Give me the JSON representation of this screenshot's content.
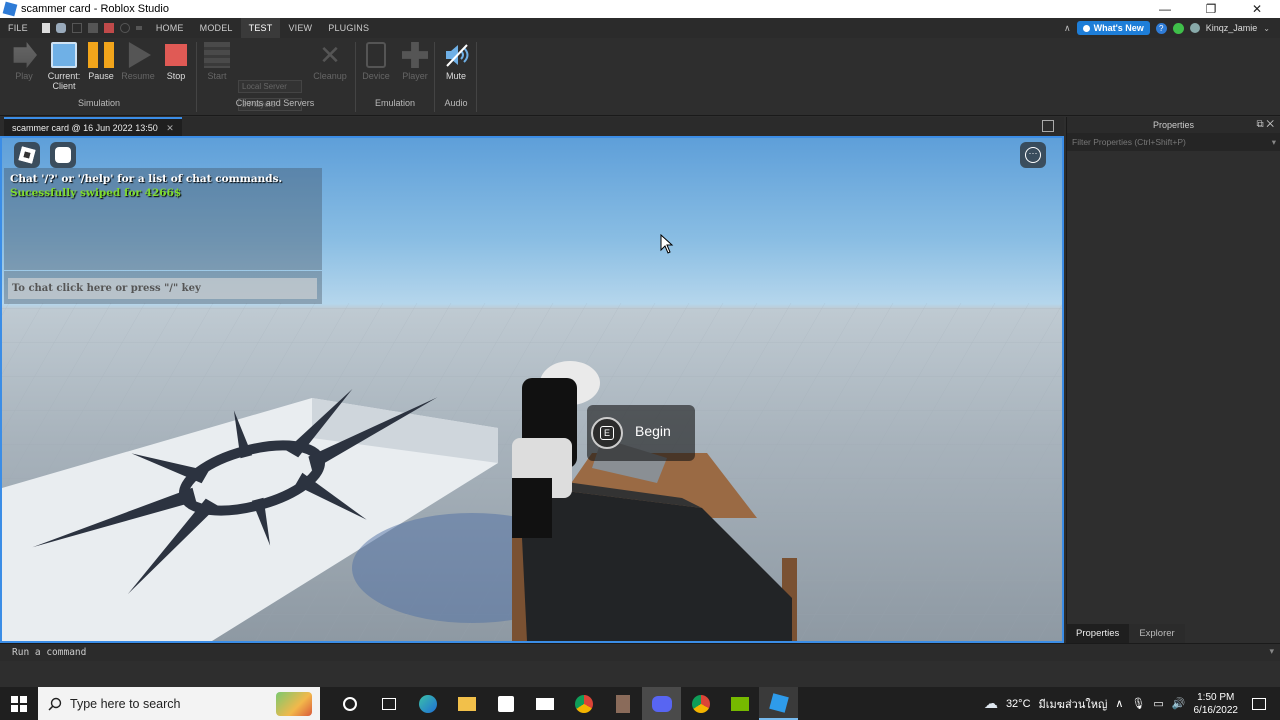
{
  "window": {
    "title": "scammer card - Roblox Studio",
    "controls": {
      "minimize": "—",
      "restore": "❐",
      "close": "✕"
    }
  },
  "menubar": {
    "file": "FILE",
    "tabs": [
      "HOME",
      "MODEL",
      "TEST",
      "VIEW",
      "PLUGINS"
    ],
    "active_tab": "TEST",
    "whats_new": "What's New",
    "username": "Kinqz_Jamie"
  },
  "ribbon": {
    "play": "Play",
    "current_client": "Current:",
    "current_client_2": "Client",
    "pause": "Pause",
    "resume": "Resume",
    "stop": "Stop",
    "simulation": "Simulation",
    "server_select": "Local Server",
    "players_select": "2 Players",
    "start": "Start",
    "cleanup": "Cleanup",
    "clients_and_servers": "Clients and Servers",
    "device": "Device",
    "player": "Player",
    "emulation": "Emulation",
    "mute": "Mute",
    "audio": "Audio"
  },
  "viewport_tab": {
    "label": "scammer card @ 16 Jun 2022 13:50",
    "close": "✕"
  },
  "game": {
    "chat_help": "Chat '/?' or '/help' for a list of chat commands.",
    "chat_message": "Sucessfully swiped for 4266$",
    "chat_placeholder": "To chat click here or press \"/\" key",
    "prompt_key": "E",
    "prompt_label": "Begin"
  },
  "properties_panel": {
    "title": "Properties",
    "filter_placeholder": "Filter Properties (Ctrl+Shift+P)",
    "tabs": [
      "Properties",
      "Explorer"
    ]
  },
  "command_bar": {
    "placeholder": "Run a command"
  },
  "taskbar": {
    "search_placeholder": "Type here to search",
    "weather": "32°C",
    "location": "มีเมฆส่วนใหญ่",
    "time": "1:50 PM",
    "date": "6/16/2022"
  },
  "colors": {
    "accent": "#3b8de6",
    "whats_new": "#1e7ed8",
    "chat_green": "#7fdc2d",
    "pause_orange": "#f2a51b",
    "stop_red": "#e05a55"
  }
}
